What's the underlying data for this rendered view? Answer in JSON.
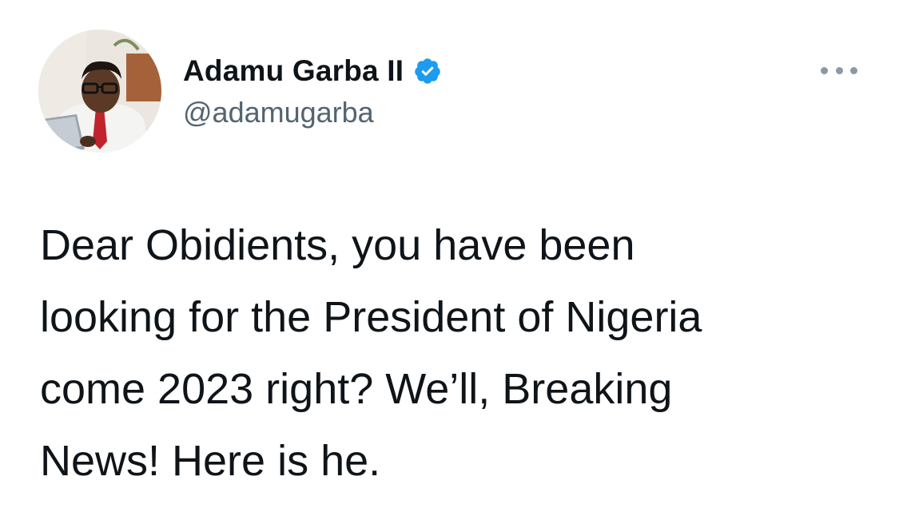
{
  "tweet": {
    "author": {
      "display_name": "Adamu Garba II",
      "handle": "@adamugarba",
      "verified": true,
      "verified_icon": "verified-badge-icon",
      "verified_color": "#1d9bf0"
    },
    "more_icon": "more-options-icon",
    "text_lines": [
      "Dear Obidients, you have been",
      "looking for the President of Nigeria",
      "come 2023 right? We’ll, Breaking",
      "News! Here is he."
    ]
  }
}
